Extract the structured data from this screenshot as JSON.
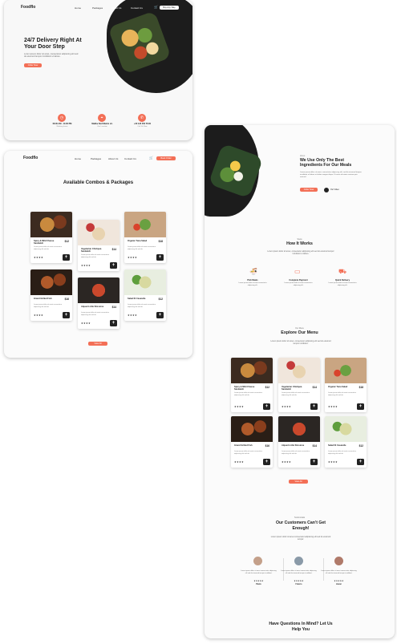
{
  "brand": "Foodflo",
  "colors": {
    "accent": "#f36f56",
    "dark": "#1b1b1b",
    "card": "#fbfbfb"
  },
  "hero_page": {
    "nav": [
      "Home",
      "Packages",
      "About Us",
      "Contact Us"
    ],
    "cart_icon": "cart-icon",
    "cta": "Buy Any Way",
    "title": "24/7 Delivery Right At Your Door Step",
    "subtitle": "Lorem ipsum dolor sit amet, consectetur adipiscing elit sed do eiusmod tempor incididunt ut labore.",
    "button": "Order Now",
    "info": [
      {
        "icon": "clock-icon",
        "value": "08.00 AM - 10.00 PM",
        "label": "Working hours"
      },
      {
        "icon": "location-icon",
        "value": "Malibu Northfields str.",
        "label": "Our Location"
      },
      {
        "icon": "phone-icon",
        "value": "+00 123 456 78 90",
        "label": "Call Us Now"
      }
    ]
  },
  "packages_page": {
    "nav": [
      "Home",
      "Packages",
      "About Us",
      "Contact Us"
    ],
    "cta": "Book Order",
    "title": "Available Combos & Packages",
    "dishes": [
      {
        "name": "Spicy & Mild Cheese Sandwich",
        "price": "$12",
        "desc": "Lorem ipsum dolor sit amet consectetur adipiscing elit sed do.",
        "stars": "★★★★"
      },
      {
        "name": "Vegetarian Chickpea Sandwich",
        "price": "$14",
        "desc": "Lorem ipsum dolor sit amet consectetur adipiscing elit sed do.",
        "stars": "★★★★"
      },
      {
        "name": "Organic Tuna Salad",
        "price": "$18",
        "desc": "Lorem ipsum dolor sit amet consectetur adipiscing elit sed do.",
        "stars": "★★★★"
      },
      {
        "name": "Grand Grilled Fish",
        "price": "$16",
        "desc": "Lorem ipsum dolor sit amet consectetur adipiscing elit sed do.",
        "stars": "★★★★"
      },
      {
        "name": "Alquerin Alle Sticsione",
        "price": "$14",
        "desc": "Lorem ipsum dolor sit amet consectetur adipiscing elit sed do.",
        "stars": "★★★★"
      },
      {
        "name": "Salad Di Casarelle",
        "price": "$12",
        "desc": "Lorem ipsum dolor sit amet consectetur adipiscing elit sed do.",
        "stars": "★★★★"
      }
    ],
    "button": "View All"
  },
  "home_page": {
    "about_tag": "About",
    "about_title": "We Use Only The Best Ingredients For Our Meals",
    "about_text": "Lorem ipsum dolor sit amet, consectetur adipiscing elit, sed do eiusmod tempor incididunt ut labore et dolore magna aliqua. Ut enim ad minim veniam quis nostrud.",
    "about_button": "Order Now",
    "about_play": "Our Video",
    "works_tag": "Steps",
    "works_title": "How It Works",
    "works_text": "Lorem ipsum dolor sit amet, consectetur adipiscing elit sed do eiusmod tempor incididunt ut labore.",
    "steps": [
      {
        "icon": "bowl-icon",
        "title": "Pick Meals",
        "text": "Lorem ipsum dolor sit amet consectetur adipiscing elit."
      },
      {
        "icon": "card-icon",
        "title": "Complete Payment",
        "text": "Lorem ipsum dolor sit amet consectetur adipiscing elit."
      },
      {
        "icon": "truck-icon",
        "title": "Quick Delivery",
        "text": "Lorem ipsum dolor sit amet consectetur adipiscing elit."
      }
    ],
    "menu_tag": "Our Menu",
    "menu_title": "Explore Our Menu",
    "menu_text": "Lorem ipsum dolor sit amet, consectetur adipiscing elit sed do eiusmod tempor incididunt.",
    "menu_button": "View All",
    "testi_tag": "Testimonials",
    "testi_title": "Our Customers Can't Get Enough!",
    "testi_text": "Lorem ipsum dolor sit amet consectetur adipiscing elit sed do eiusmod tempor.",
    "testimonials": [
      {
        "text": "Lorem ipsum dolor sit amet consectetur adipiscing elit sed do eiusmod tempor incididunt.",
        "stars": "★★★★★",
        "name": "Paolo"
      },
      {
        "text": "Lorem ipsum dolor sit amet consectetur adipiscing elit sed do eiusmod tempor incididunt.",
        "stars": "★★★★★",
        "name": "Franco"
      },
      {
        "text": "Lorem ipsum dolor sit amet consectetur adipiscing elit sed do eiusmod tempor incididunt.",
        "stars": "★★★★★",
        "name": "Jason"
      }
    ],
    "faq_title": "Have Questions In Mind? Let Us Help You"
  }
}
